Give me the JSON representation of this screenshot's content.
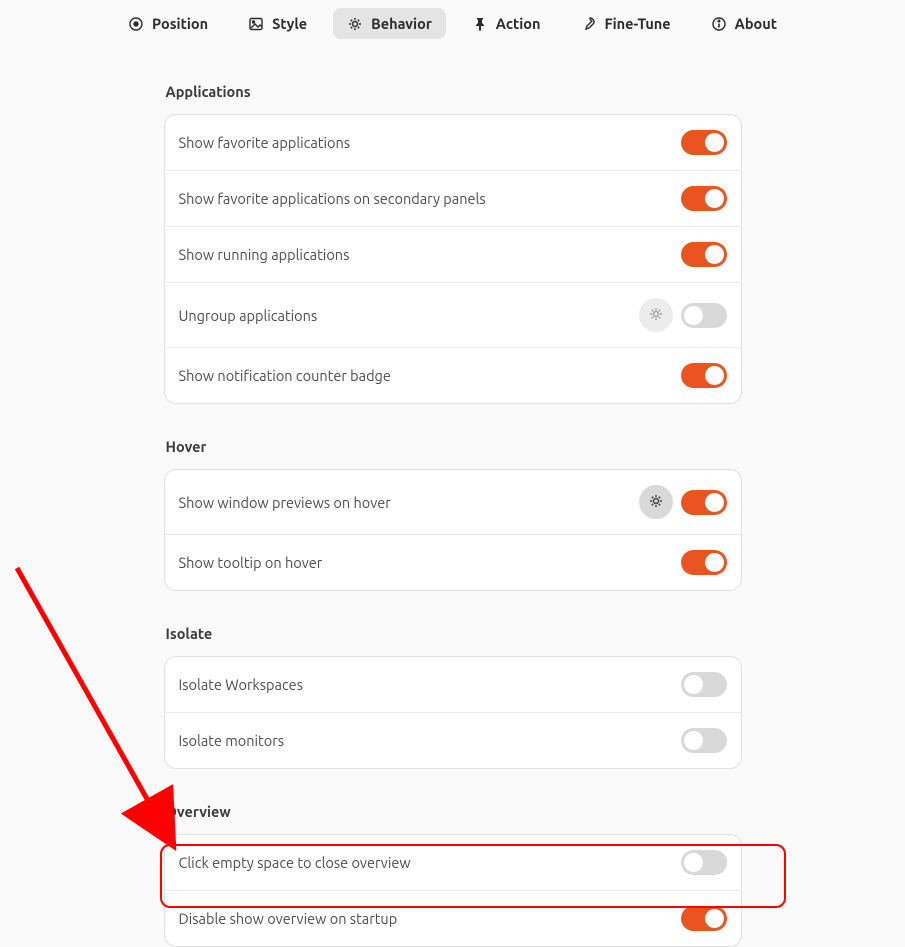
{
  "tabs": [
    {
      "label": "Position",
      "selected": false
    },
    {
      "label": "Style",
      "selected": false
    },
    {
      "label": "Behavior",
      "selected": true
    },
    {
      "label": "Action",
      "selected": false
    },
    {
      "label": "Fine-Tune",
      "selected": false
    },
    {
      "label": "About",
      "selected": false
    }
  ],
  "sections": {
    "applications": {
      "title": "Applications",
      "rows": [
        {
          "label": "Show favorite applications",
          "on": true
        },
        {
          "label": "Show favorite applications on secondary panels",
          "on": true
        },
        {
          "label": "Show running applications",
          "on": true
        },
        {
          "label": "Ungroup applications",
          "on": false,
          "gear": "light"
        },
        {
          "label": "Show notification counter badge",
          "on": true
        }
      ]
    },
    "hover": {
      "title": "Hover",
      "rows": [
        {
          "label": "Show window previews on hover",
          "on": true,
          "gear": "dark"
        },
        {
          "label": "Show tooltip on hover",
          "on": true
        }
      ]
    },
    "isolate": {
      "title": "Isolate",
      "rows": [
        {
          "label": "Isolate Workspaces",
          "on": false
        },
        {
          "label": "Isolate monitors",
          "on": false
        }
      ]
    },
    "overview": {
      "title": "Overview",
      "rows": [
        {
          "label": "Click empty space to close overview",
          "on": false
        },
        {
          "label": "Disable show overview on startup",
          "on": true
        }
      ]
    }
  }
}
